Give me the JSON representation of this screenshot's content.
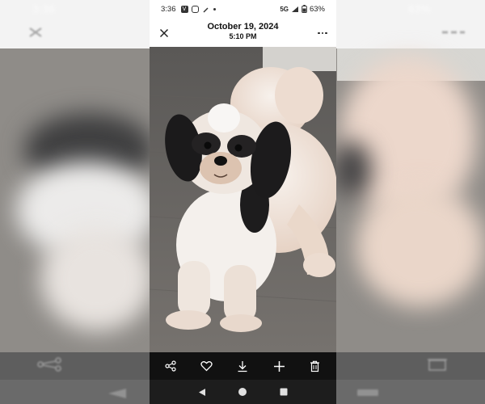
{
  "status_bar": {
    "time": "3:36",
    "app_icons": [
      "app-notification-icon",
      "instagram-icon",
      "pen-icon"
    ],
    "network": "5G",
    "battery": "63%"
  },
  "header": {
    "date": "October 19, 2024",
    "time": "5:10 PM",
    "close_icon": "close-icon",
    "more_icon": "more-options-icon"
  },
  "photo": {
    "subject": "shih-tzu-dog"
  },
  "action_bar": {
    "items": [
      {
        "icon": "share-icon"
      },
      {
        "icon": "heart-icon"
      },
      {
        "icon": "download-icon"
      },
      {
        "icon": "plus-icon"
      },
      {
        "icon": "trash-icon"
      }
    ]
  },
  "nav_bar": {
    "items": [
      {
        "icon": "back-icon"
      },
      {
        "icon": "home-icon"
      },
      {
        "icon": "recents-icon"
      }
    ]
  },
  "colors": {
    "action_bar_bg": "#111111",
    "nav_bar_bg": "#1d1d1d",
    "header_bg": "#ffffff"
  }
}
